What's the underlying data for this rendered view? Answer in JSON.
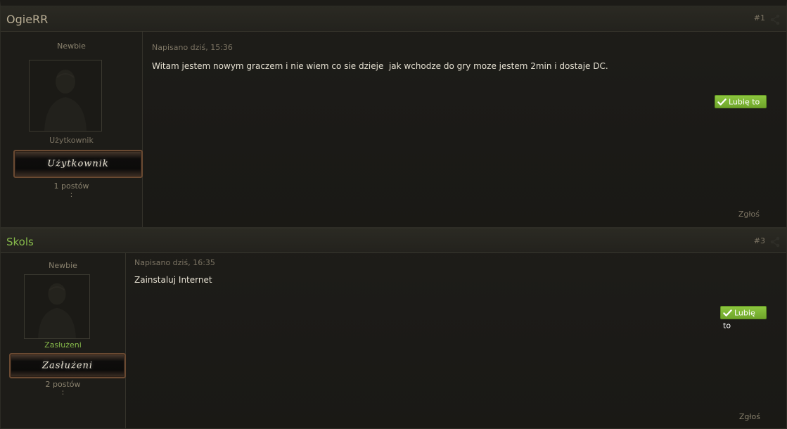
{
  "posts": [
    {
      "author": "OgieRR",
      "post_number": "#1",
      "rank": "Newbie",
      "group": "Użytkownik",
      "group_badge": "Użytkownik",
      "post_count": "1 postów",
      "colon": ":",
      "date": "Napisano dziś, 15:36",
      "content": "Witam jestem nowym graczem i nie wiem co sie dzieje  jak wchodze do gry moze jestem 2min i dostaje DC.",
      "like_label": "Lubię to",
      "report_label": "Zgłoś"
    },
    {
      "author": "Skols",
      "post_number": "#3",
      "rank": "Newbie",
      "group": "Zasłużeni",
      "group_badge": "Zasłużeni",
      "post_count": "2 postów",
      "colon": ":",
      "date": "Napisano dziś, 16:35",
      "content": "Zainstaluj Internet",
      "like_label": "Lubię to",
      "report_label": "Zgłoś"
    }
  ],
  "colors": {
    "author_default": "#b8ad94",
    "author_green": "#86b94a",
    "like_button": "#8cc63f",
    "muted_text": "#7d7564"
  },
  "icons": {
    "share": "share-icon",
    "like": "check-icon",
    "avatar": "default-avatar-silhouette"
  }
}
